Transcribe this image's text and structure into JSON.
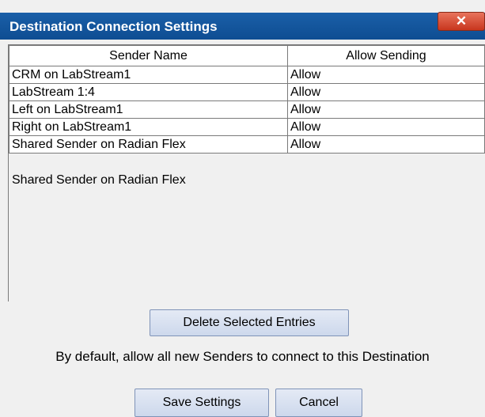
{
  "window": {
    "title": "Destination Connection Settings",
    "close_label": "✕"
  },
  "table": {
    "headers": [
      "Sender Name",
      "Allow Sending"
    ],
    "rows": [
      {
        "name": "CRM on LabStream1",
        "allow": "Allow"
      },
      {
        "name": "LabStream 1:4",
        "allow": "Allow"
      },
      {
        "name": "Left on LabStream1",
        "allow": "Allow"
      },
      {
        "name": "Right on LabStream1",
        "allow": "Allow"
      },
      {
        "name": "Shared Sender on Radian Flex",
        "allow": "Allow"
      }
    ]
  },
  "selected_entry": "Shared Sender on Radian Flex",
  "buttons": {
    "delete": "Delete Selected Entries",
    "save": "Save Settings",
    "cancel": "Cancel"
  },
  "default_text": "By default, allow all new Senders to connect to this Destination",
  "colors": {
    "titlebar": "#0e4d92",
    "close_button": "#c8361e",
    "button_face": "#cdd8ec"
  }
}
